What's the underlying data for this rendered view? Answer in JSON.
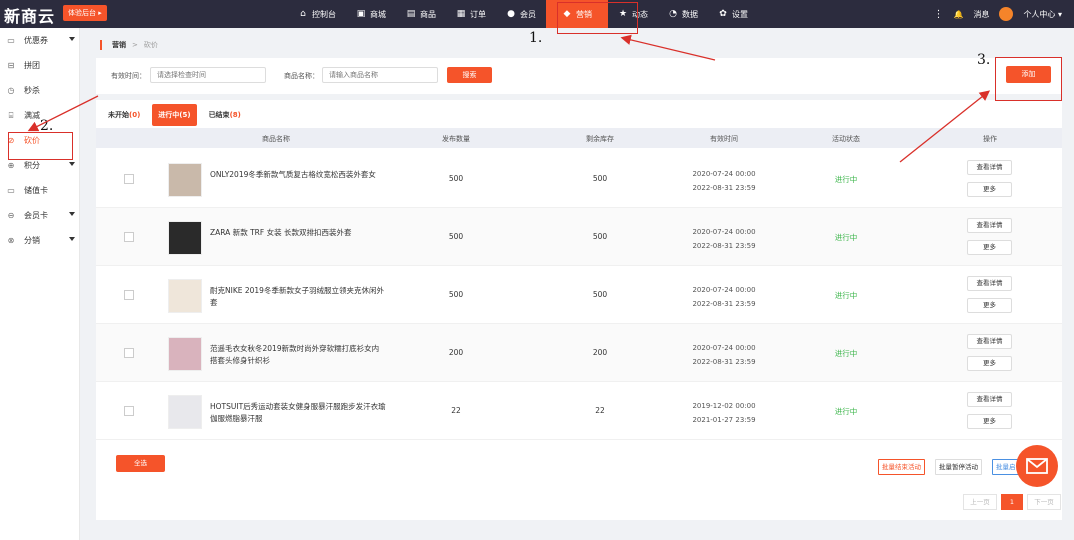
{
  "topbar": {
    "logo": "新商云",
    "trial_label": "体验后台 ▸",
    "nav": [
      {
        "label": "控制台",
        "icon": "home-icon",
        "glyph": "⌂"
      },
      {
        "label": "商城",
        "icon": "shop-icon",
        "glyph": "▣"
      },
      {
        "label": "商品",
        "icon": "goods-icon",
        "glyph": "▤"
      },
      {
        "label": "订单",
        "icon": "order-icon",
        "glyph": "▦"
      },
      {
        "label": "会员",
        "icon": "member-icon",
        "glyph": "●"
      },
      {
        "label": "营销",
        "icon": "marketing-icon",
        "glyph": "◆",
        "active": true
      },
      {
        "label": "动态",
        "icon": "star-icon",
        "glyph": "★"
      },
      {
        "label": "数据",
        "icon": "chart-icon",
        "glyph": "◔"
      },
      {
        "label": "设置",
        "icon": "gear-icon",
        "glyph": "✿"
      }
    ],
    "more": "⋮",
    "bell": "🔔",
    "messages": "消息",
    "user": "个人中心 ▾"
  },
  "sidebar": {
    "items": [
      {
        "label": "优惠券",
        "glyph": "▭",
        "caret": true
      },
      {
        "label": "拼团",
        "glyph": "⊟",
        "caret": false
      },
      {
        "label": "秒杀",
        "glyph": "◷",
        "caret": false
      },
      {
        "label": "满减",
        "glyph": "⌸",
        "caret": false
      },
      {
        "label": "砍价",
        "glyph": "⊘",
        "caret": false,
        "active": true
      },
      {
        "label": "积分",
        "glyph": "⊕",
        "caret": true
      },
      {
        "label": "储值卡",
        "glyph": "▭",
        "caret": false
      },
      {
        "label": "会员卡",
        "glyph": "⊖",
        "caret": true
      },
      {
        "label": "分销",
        "glyph": "⊗",
        "caret": true
      }
    ]
  },
  "breadcrumb": {
    "root": "营销",
    "sep": ">",
    "current": "砍价"
  },
  "filters": {
    "time_label": "有效时间：",
    "time_placeholder": "请选择检查时间",
    "name_label": "商品名称：",
    "name_placeholder": "请输入商品名称",
    "search": "搜索"
  },
  "add_label": "添加",
  "tabs": [
    {
      "label": "未开始",
      "count": "(0)"
    },
    {
      "label": "进行中",
      "count": "(5)",
      "active": true
    },
    {
      "label": "已结束",
      "count": "(8)"
    }
  ],
  "columns": [
    "商品名称",
    "发布数量",
    "剩余库存",
    "有效时间",
    "活动状态",
    "操作"
  ],
  "rows": [
    {
      "name": "ONLY2019冬季新款气质复古格纹宽松西装外套女",
      "qty": "500",
      "stock": "500",
      "start": "2020-07-24 00:00",
      "end": "2022-08-31 23:59",
      "status": "进行中",
      "thumb": "#c9b9aa"
    },
    {
      "name": "ZARA 新款 TRF 女装 长款双排扣西装外套",
      "qty": "500",
      "stock": "500",
      "start": "2020-07-24 00:00",
      "end": "2022-08-31 23:59",
      "status": "进行中",
      "thumb": "#2a2a2a"
    },
    {
      "name": "耐克NIKE 2019冬季新款女子羽绒服立领夹克休闲外套",
      "qty": "500",
      "stock": "500",
      "start": "2020-07-24 00:00",
      "end": "2022-08-31 23:59",
      "status": "进行中",
      "thumb": "#efe6da"
    },
    {
      "name": "范遥毛衣女秋冬2019新款时尚外穿软糯打底衫女内搭套头修身针织衫",
      "qty": "200",
      "stock": "200",
      "start": "2020-07-24 00:00",
      "end": "2022-08-31 23:59",
      "status": "进行中",
      "thumb": "#d9b3bd"
    },
    {
      "name": "HOTSUIT后秀运动套装女健身服暴汗服跑步发汗衣瑜伽服燃脂暴汗服",
      "qty": "22",
      "stock": "22",
      "start": "2019-12-02 00:00",
      "end": "2021-01-27 23:59",
      "status": "进行中",
      "thumb": "#e8e8ec"
    }
  ],
  "row_actions": {
    "detail": "查看详情",
    "more": "更多"
  },
  "footer": {
    "select_all": "全选",
    "batch_end": "批量结束活动",
    "batch_pause": "批量暂停活动",
    "batch_third": "批量启",
    "prev": "上一页",
    "page": "1",
    "next": "下一页"
  },
  "annotations": {
    "n1": "1.",
    "n2": "2.",
    "n3": "3."
  },
  "colors": {
    "accent": "#f5542a",
    "topbar": "#2c2c3e",
    "status_active": "#3bb54a",
    "annotation": "#d9302a"
  }
}
